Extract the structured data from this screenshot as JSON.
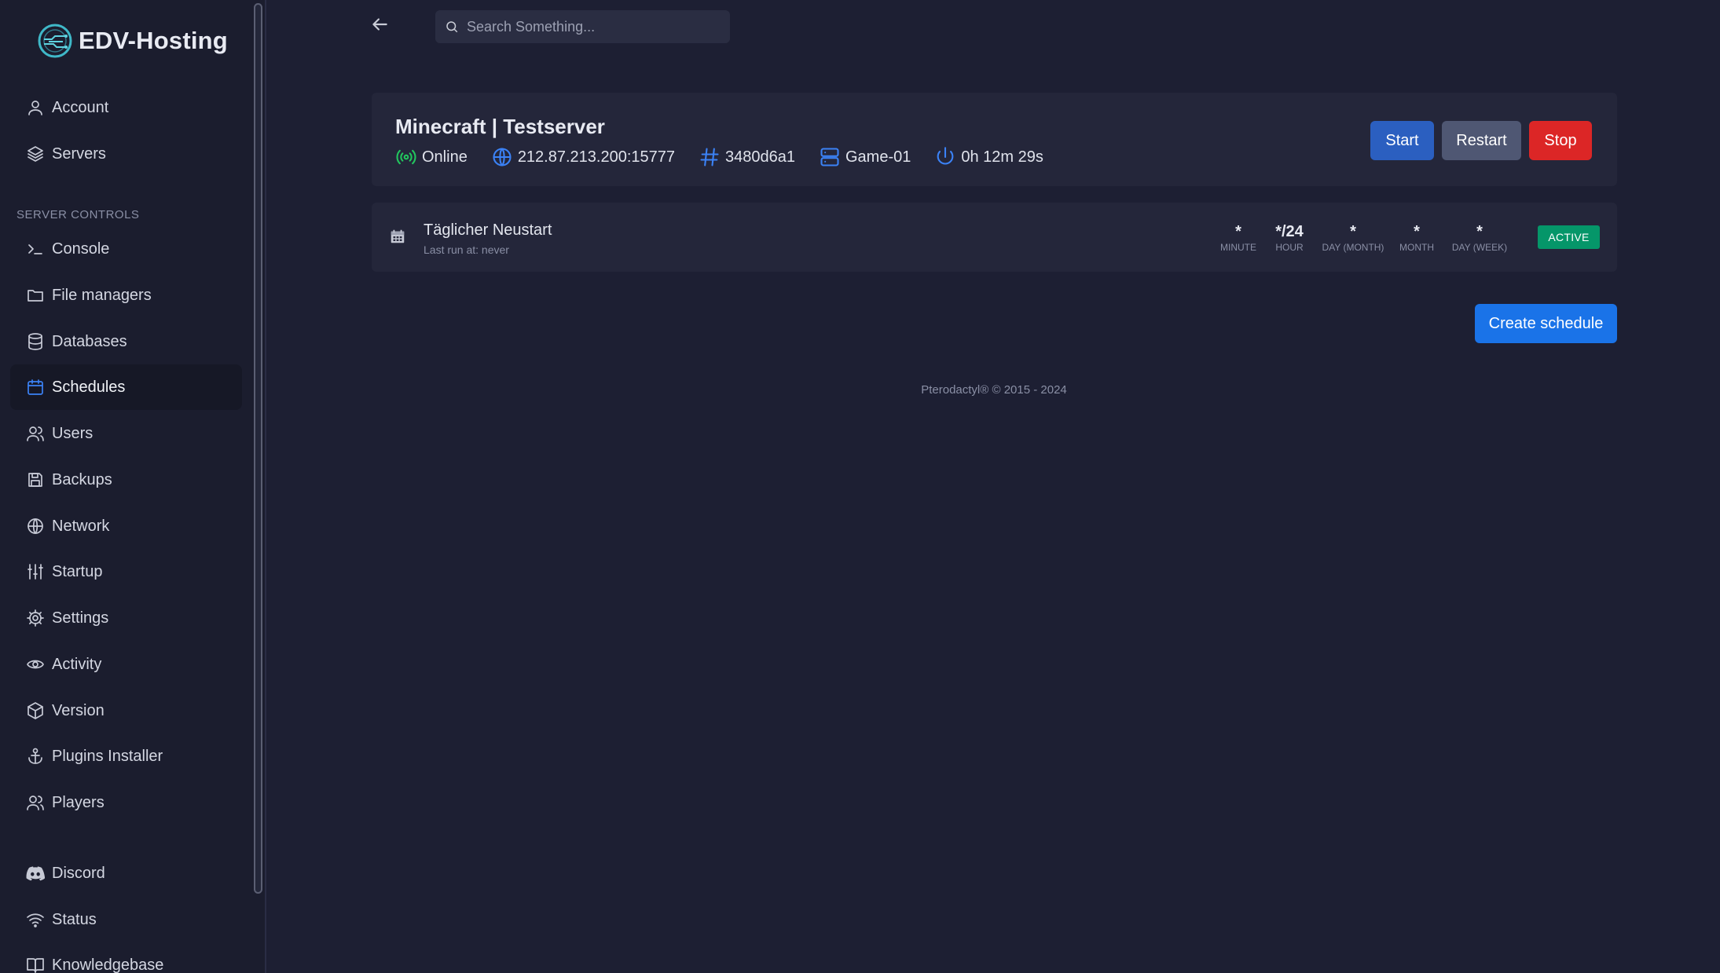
{
  "brand": {
    "name": "EDV-Hosting"
  },
  "nav_top": [
    {
      "label": "Account",
      "icon": "user-icon"
    },
    {
      "label": "Servers",
      "icon": "layers-icon"
    }
  ],
  "section_title": "SERVER CONTROLS",
  "nav_controls": [
    {
      "label": "Console",
      "icon": "terminal-icon"
    },
    {
      "label": "File managers",
      "icon": "folder-icon"
    },
    {
      "label": "Databases",
      "icon": "database-icon"
    },
    {
      "label": "Schedules",
      "icon": "calendar-icon",
      "active": true
    },
    {
      "label": "Users",
      "icon": "users-icon"
    },
    {
      "label": "Backups",
      "icon": "save-icon"
    },
    {
      "label": "Network",
      "icon": "globe-icon"
    },
    {
      "label": "Startup",
      "icon": "sliders-icon"
    },
    {
      "label": "Settings",
      "icon": "gear-icon"
    },
    {
      "label": "Activity",
      "icon": "eye-icon"
    },
    {
      "label": "Version",
      "icon": "box-icon"
    },
    {
      "label": "Plugins Installer",
      "icon": "anchor-icon"
    },
    {
      "label": "Players",
      "icon": "users-icon"
    }
  ],
  "nav_bottom": [
    {
      "label": "Discord",
      "icon": "discord-icon"
    },
    {
      "label": "Status",
      "icon": "wifi-icon"
    },
    {
      "label": "Knowledgebase",
      "icon": "book-icon"
    }
  ],
  "search": {
    "placeholder": "Search Something..."
  },
  "server": {
    "name": "Minecraft | Testserver",
    "status": "Online",
    "address": "212.87.213.200:15777",
    "id": "3480d6a1",
    "node": "Game-01",
    "uptime": "0h 12m 29s",
    "buttons": {
      "start": "Start",
      "restart": "Restart",
      "stop": "Stop"
    }
  },
  "schedule": {
    "name": "Täglicher Neustart",
    "last_run": "Last run at: never",
    "cron": [
      {
        "value": "*",
        "label": "MINUTE"
      },
      {
        "value": "*/24",
        "label": "HOUR"
      },
      {
        "value": "*",
        "label": "DAY (MONTH)"
      },
      {
        "value": "*",
        "label": "MONTH"
      },
      {
        "value": "*",
        "label": "DAY (WEEK)"
      }
    ],
    "status_badge": "ACTIVE"
  },
  "create_schedule_label": "Create schedule",
  "footer": "Pterodactyl® © 2015 - 2024",
  "colors": {
    "accent": "#1a73e8",
    "online": "#22c55e",
    "stop": "#dc2626",
    "active_badge": "#059669"
  }
}
